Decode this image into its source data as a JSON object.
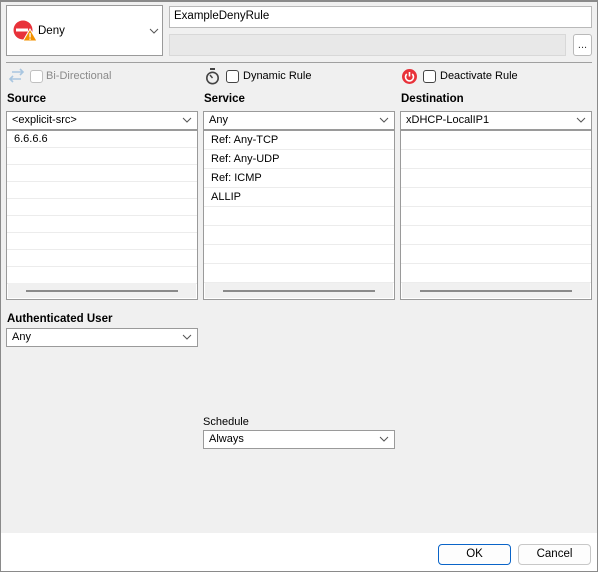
{
  "action": {
    "value": "Deny",
    "icon": "deny-warning-icon"
  },
  "rule_name": {
    "value": "ExampleDenyRule"
  },
  "comment": {
    "value": "",
    "more_button_label": "..."
  },
  "options": {
    "bidirectional": {
      "label": "Bi-Directional",
      "checked": false,
      "disabled": true
    },
    "dynamic": {
      "label": "Dynamic Rule",
      "checked": false
    },
    "deactivate": {
      "label": "Deactivate Rule",
      "checked": false
    }
  },
  "source": {
    "label": "Source",
    "selected": "<explicit-src>",
    "items": [
      "6.6.6.6"
    ]
  },
  "service": {
    "label": "Service",
    "selected": "Any",
    "items": [
      "Ref: Any-TCP",
      "Ref: Any-UDP",
      "Ref: ICMP",
      "ALLIP"
    ]
  },
  "destination": {
    "label": "Destination",
    "selected": "xDHCP-LocalIP1",
    "items": []
  },
  "auth_user": {
    "label": "Authenticated User",
    "selected": "Any"
  },
  "schedule": {
    "label": "Schedule",
    "selected": "Always"
  },
  "buttons": {
    "ok": "OK",
    "cancel": "Cancel"
  },
  "colors": {
    "deny_red": "#e8323a",
    "warning_orange": "#f39200",
    "ok_border": "#0a64c8"
  }
}
